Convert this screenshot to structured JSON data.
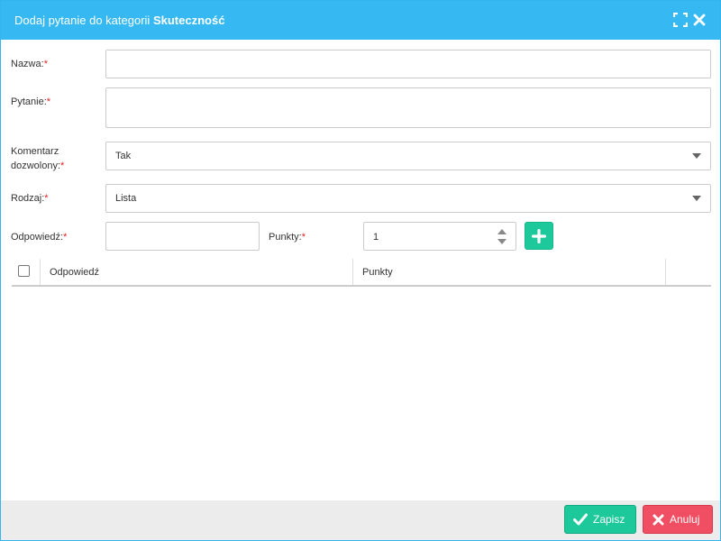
{
  "dialog": {
    "title_prefix": "Dodaj pytanie do kategorii",
    "title_category": "Skuteczność",
    "icons": {
      "maximize": "maximize-icon",
      "close": "close-icon"
    }
  },
  "form": {
    "name": {
      "label": "Nazwa:",
      "required_mark": "*",
      "value": ""
    },
    "question": {
      "label": "Pytanie:",
      "required_mark": "*",
      "value": ""
    },
    "comment_allowed": {
      "label_line1": "Komentarz",
      "label_line2": "dozwolony:",
      "required_mark": "*",
      "value": "Tak"
    },
    "type": {
      "label": "Rodzaj:",
      "required_mark": "*",
      "value": "Lista"
    },
    "answer": {
      "label": "Odpowiedź:",
      "required_mark": "*",
      "value": ""
    },
    "points": {
      "label": "Punkty:",
      "required_mark": "*",
      "value": "1"
    },
    "add_icon": "plus-icon"
  },
  "table": {
    "columns": [
      "Odpowiedź",
      "Punkty"
    ]
  },
  "footer": {
    "save_label": "Zapisz",
    "cancel_label": "Anuluj",
    "save_icon": "check-icon",
    "cancel_icon": "x-icon"
  },
  "colors": {
    "header": "#36b9f2",
    "save": "#1dc99b",
    "cancel": "#f04e62",
    "required": "#e02020"
  }
}
